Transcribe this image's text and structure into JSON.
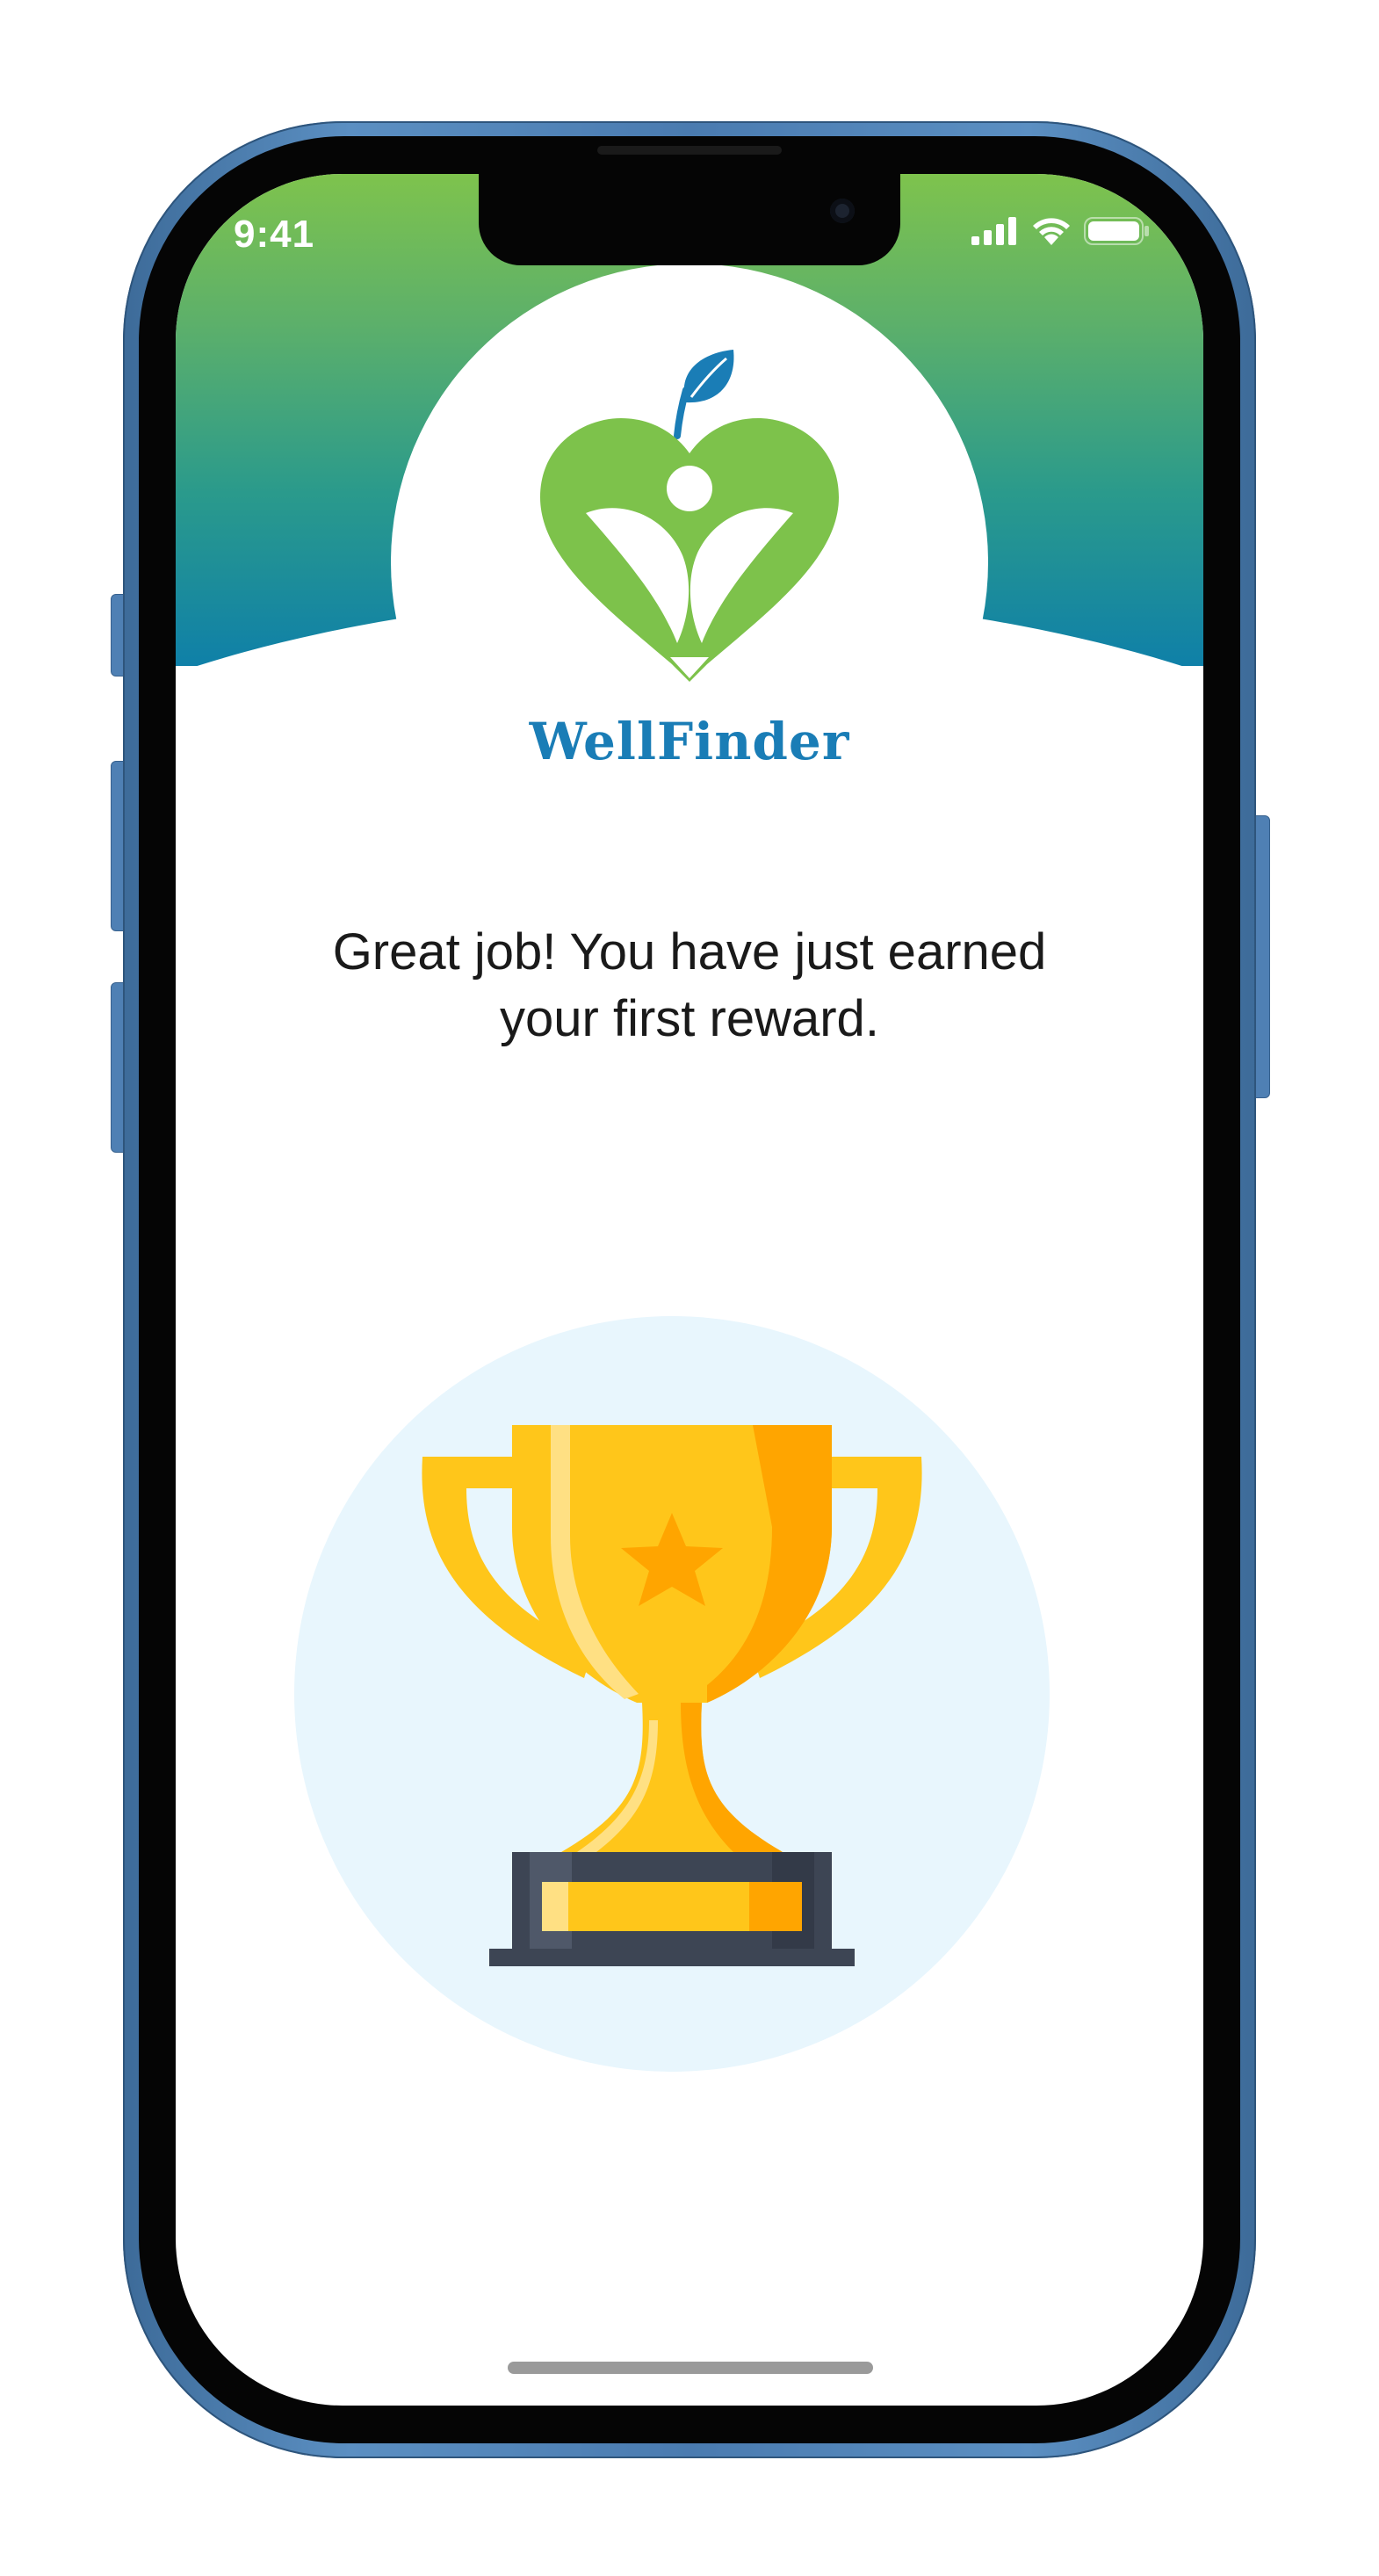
{
  "status_bar": {
    "time": "9:41",
    "signal_icon": "cellular-signal-icon",
    "wifi_icon": "wifi-icon",
    "battery_icon": "battery-icon"
  },
  "brand": {
    "logo_icon": "apple-heart-person-logo-icon",
    "name": "WellFinder"
  },
  "message": {
    "line1": "Great job! You have just earned",
    "line2": "your first reward."
  },
  "reward": {
    "icon": "trophy-icon"
  },
  "colors": {
    "header_top": "#7ec34d",
    "header_bottom": "#0f80a8",
    "brand_text": "#1a7db6",
    "logo_green": "#7dc24b",
    "leaf_blue": "#1a7db6",
    "trophy_gold": "#ffc61a",
    "trophy_orange": "#ffa500",
    "trophy_base": "#3d4554",
    "trophy_circle": "#e8f6fd"
  }
}
